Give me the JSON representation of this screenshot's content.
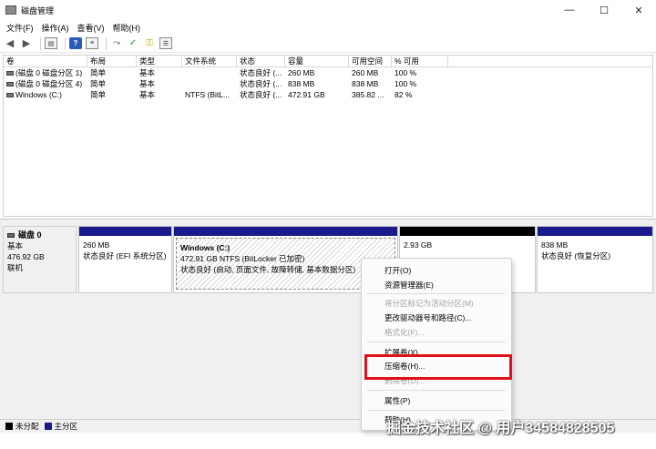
{
  "window": {
    "title": "磁盘管理",
    "minimize_glyph": "—",
    "maximize_glyph": "☐",
    "close_glyph": "✕"
  },
  "menu": [
    "文件(F)",
    "操作(A)",
    "查看(V)",
    "帮助(H)"
  ],
  "toolbar": {
    "icons": [
      "back-icon",
      "forward-icon",
      "console-tree-icon",
      "help-icon",
      "properties-icon",
      "connect-icon",
      "check-icon",
      "key-icon",
      "list-icon"
    ]
  },
  "volumes": {
    "columns": [
      "卷",
      "布局",
      "类型",
      "文件系统",
      "状态",
      "容量",
      "可用空间",
      "% 可用"
    ],
    "rows": [
      [
        "(磁盘 0 磁盘分区 1)",
        "简单",
        "基本",
        "",
        "状态良好 (...",
        "260 MB",
        "260 MB",
        "100 %"
      ],
      [
        "(磁盘 0 磁盘分区 4)",
        "简单",
        "基本",
        "",
        "状态良好 (...",
        "838 MB",
        "838 MB",
        "100 %"
      ],
      [
        "Windows (C:)",
        "简单",
        "基本",
        "NTFS (BitL...",
        "状态良好 (...",
        "472.91 GB",
        "385.82 ...",
        "82 %"
      ]
    ]
  },
  "disk": {
    "name": "磁盘 0",
    "type": "基本",
    "size": "476.92 GB",
    "status": "联机"
  },
  "partitions": {
    "p1": {
      "size": "260 MB",
      "status": "状态良好 (EFI 系统分区)"
    },
    "p2": {
      "name": "Windows (C:)",
      "size": "472.91 GB NTFS (BitLocker 已加密)",
      "status": "状态良好 (启动, 页面文件, 故障转储, 基本数据分区)"
    },
    "p3": {
      "size": "2.93 GB"
    },
    "p4": {
      "size": "838 MB",
      "status": "状态良好 (恢复分区)"
    }
  },
  "legend": {
    "unallocated": "未分配",
    "primary": "主分区",
    "unallocated_color": "#000000",
    "primary_color": "#1a1a8c"
  },
  "context_menu": {
    "open": "打开(O)",
    "explorer": "资源管理器(E)",
    "mark_active": "将分区标记为活动分区(M)",
    "change_letter": "更改驱动器号和路径(C)...",
    "format": "格式化(F)...",
    "extend": "扩展卷(X)...",
    "shrink": "压缩卷(H)...",
    "delete": "删除卷(D)...",
    "properties": "属性(P)",
    "help": "帮助(H)"
  },
  "highlight_color": "#e0101a",
  "watermark": "掘金技术社区 @ 用户34584828505"
}
